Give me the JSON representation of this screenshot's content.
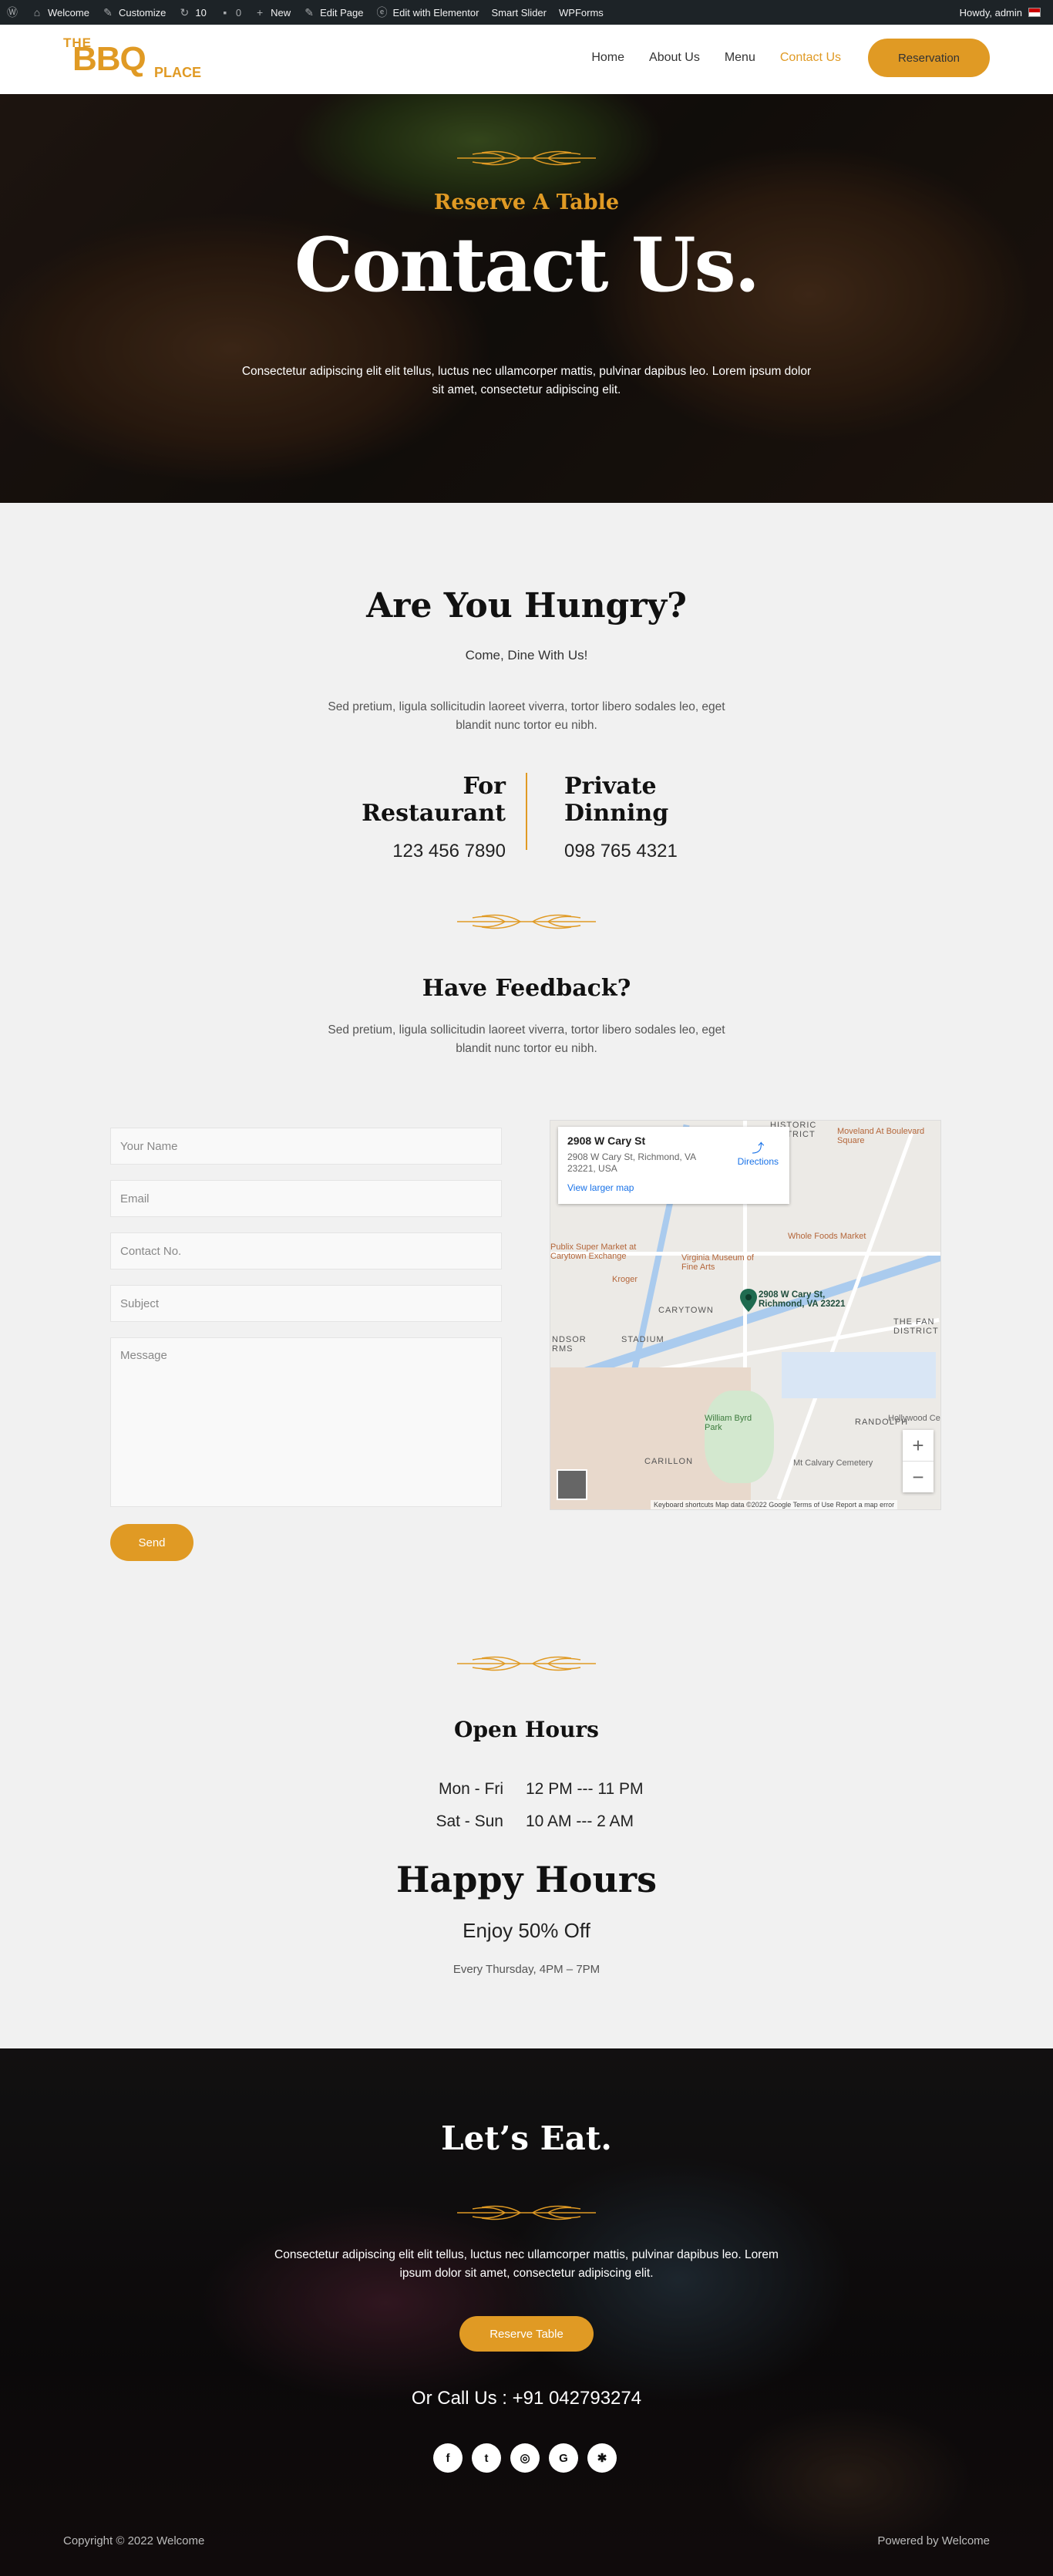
{
  "adminbar": {
    "items": [
      "Welcome",
      "Customize",
      "10",
      "0",
      "New",
      "Edit Page",
      "Edit with Elementor",
      "Smart Slider",
      "WPForms"
    ],
    "howdy": "Howdy, admin"
  },
  "header": {
    "logo": {
      "the": "THE",
      "bbq": "BBQ",
      "place": "PLACE"
    },
    "nav": [
      "Home",
      "About Us",
      "Menu",
      "Contact Us"
    ],
    "active_nav": "Contact Us",
    "cta": "Reservation"
  },
  "hero": {
    "kicker": "Reserve A Table",
    "title": "Contact Us.",
    "text": "Consectetur adipiscing elit elit tellus, luctus nec ullamcorper mattis, pulvinar dapibus leo. Lorem ipsum dolor sit amet, consectetur adipiscing elit."
  },
  "hungry": {
    "title": "Are You Hungry?",
    "subtitle": "Come, Dine With Us!",
    "text": "Sed pretium, ligula sollicitudin laoreet viverra, tortor libero sodales leo, eget blandit nunc tortor eu nibh.",
    "restaurant_title": "For Restaurant",
    "restaurant_phone": "123 456 7890",
    "private_title": "Private Dinning",
    "private_phone": "098 765 4321"
  },
  "feedback": {
    "title": "Have Feedback?",
    "text": "Sed pretium, ligula sollicitudin laoreet viverra, tortor libero sodales leo, eget blandit nunc tortor eu nibh.",
    "placeholders": {
      "name": "Your Name",
      "email": "Email",
      "contact": "Contact No.",
      "subject": "Subject",
      "message": "Message"
    },
    "send": "Send"
  },
  "map": {
    "card_title": "2908 W Cary St",
    "card_address": "2908 W Cary St, Richmond, VA 23221, USA",
    "view_larger": "View larger map",
    "directions": "Directions",
    "pin_label": "2908 W Cary St, Richmond, VA 23221",
    "labels": [
      "HISTORIC DISTRICT",
      "CARYTOWN",
      "STADIUM",
      "CARILLON",
      "RANDOLPH",
      "THE FAN DISTRICT",
      "NDSOR RMS"
    ],
    "pois": [
      "Moveland At Boulevard Square",
      "Whole Foods Market",
      "Publix Super Market at Carytown Exchange",
      "Virginia Museum of Fine Arts",
      "Kroger",
      "William Byrd Park",
      "Mt Calvary Cemetery",
      "Hollywood Ce"
    ],
    "footer": "Keyboard shortcuts   Map data ©2022 Google   Terms of Use   Report a map error",
    "zoom_in": "+",
    "zoom_out": "−"
  },
  "hours": {
    "title": "Open Hours",
    "rows": [
      {
        "days": "Mon - Fri",
        "time": "12 PM --- 11 PM"
      },
      {
        "days": "Sat - Sun",
        "time": "10 AM --- 2 AM"
      }
    ],
    "happy_title": "Happy Hours",
    "happy_offer": "Enjoy 50% Off",
    "happy_when": "Every Thursday, 4PM – 7PM"
  },
  "footer": {
    "title": "Let’s Eat.",
    "text": "Consectetur adipiscing elit elit tellus, luctus nec ullamcorper mattis, pulvinar dapibus leo. Lorem ipsum dolor sit amet, consectetur adipiscing elit.",
    "cta": "Reserve Table",
    "call": "Or Call Us : +91 042793274",
    "socials": [
      "facebook-icon",
      "twitter-icon",
      "instagram-icon",
      "google-icon",
      "yelp-icon"
    ],
    "copyright": "Copyright © 2022 Welcome",
    "powered": "Powered by Welcome"
  },
  "colors": {
    "accent": "#e09a24",
    "adminbar": "#1d2327"
  }
}
